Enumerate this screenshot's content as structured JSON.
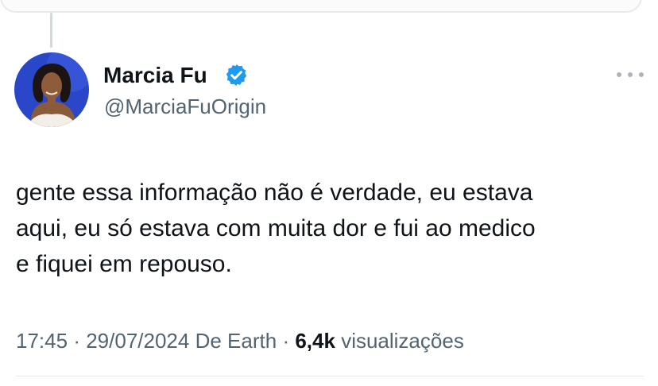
{
  "author": {
    "display_name": "Marcia Fu",
    "handle": "@MarciaFuOrigin",
    "verified": true
  },
  "tweet": {
    "lines": [
      "gente essa informação não é verdade, eu estava",
      "aqui, eu só estava com muita dor e fui ao medico",
      "e fiquei em repouso."
    ]
  },
  "meta": {
    "time": "17:45",
    "separator": "·",
    "date": "29/07/2024",
    "source": "De Earth",
    "views_count": "6,4k",
    "views_label": "visualizações"
  },
  "icons": {
    "verified": "verified-badge-icon",
    "more": "more-options-icon"
  },
  "colors": {
    "verified_blue": "#1d9bf0",
    "text_primary": "#0f1419",
    "text_secondary": "#536471",
    "avatar_background": "#2a46c9"
  }
}
